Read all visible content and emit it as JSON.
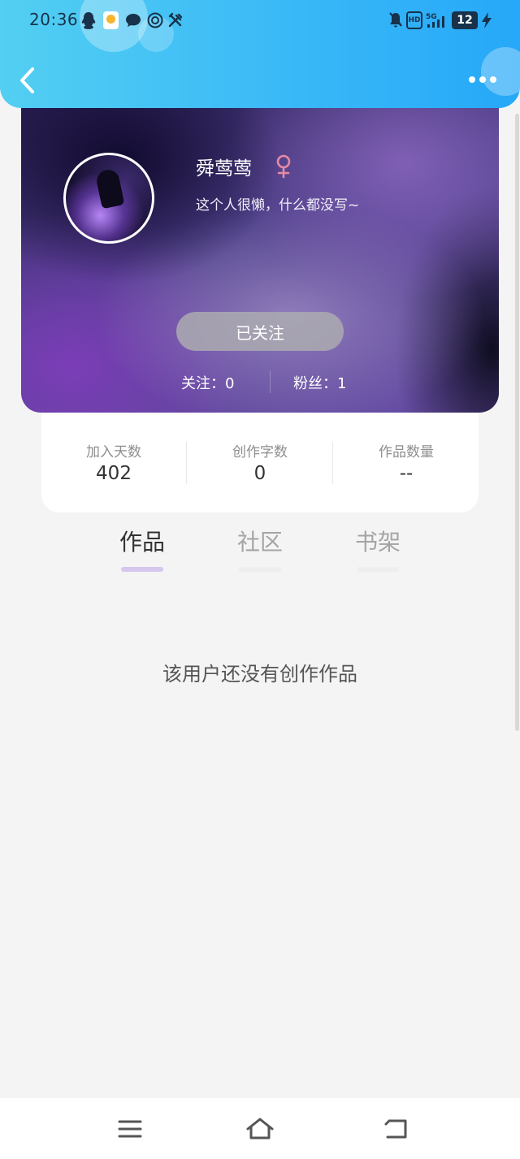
{
  "status_bar": {
    "time": "20:36",
    "hd_label": "HD",
    "network_label": "5G",
    "battery_level": "12"
  },
  "profile": {
    "username": "舜莺莺",
    "gender_icon": "female-symbol",
    "bio": "这个人很懒，什么都没写~",
    "follow_button_label": "已关注",
    "follow_stat": "关注：0",
    "fans_stat": "粉丝：1"
  },
  "stats": [
    {
      "label": "加入天数",
      "value": "402"
    },
    {
      "label": "创作字数",
      "value": "0"
    },
    {
      "label": "作品数量",
      "value": "--"
    }
  ],
  "tabs": [
    {
      "label": "作品",
      "active": true
    },
    {
      "label": "社区",
      "active": false
    },
    {
      "label": "书架",
      "active": false
    }
  ],
  "empty_state": "该用户还没有创作作品",
  "colors": {
    "header_gradient_start": "#53cff2",
    "header_gradient_end": "#26a8f8",
    "gender_color": "#e58aa6",
    "active_tab_underline": "#d5c7ee"
  }
}
